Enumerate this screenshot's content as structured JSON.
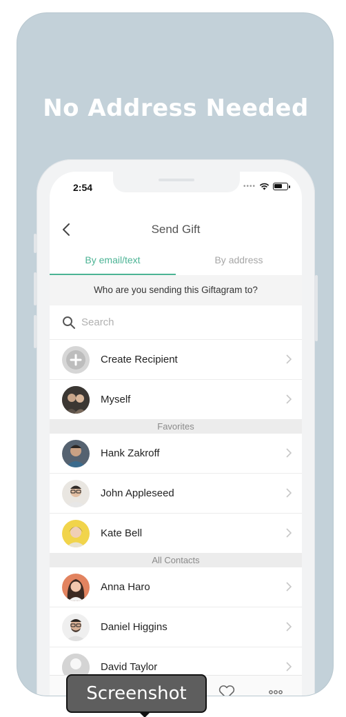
{
  "headline": "No Address Needed",
  "status": {
    "time": "2:54"
  },
  "nav": {
    "title": "Send Gift"
  },
  "tabs": [
    {
      "label": "By email/text",
      "active": true
    },
    {
      "label": "By address",
      "active": false
    }
  ],
  "prompt": "Who are you sending this Giftagram to?",
  "search": {
    "placeholder": "Search"
  },
  "actions": [
    {
      "label": "Create Recipient",
      "icon": "plus-icon"
    },
    {
      "label": "Myself",
      "icon": "avatar"
    }
  ],
  "sections": {
    "favorites": {
      "title": "Favorites",
      "items": [
        "Hank Zakroff",
        "John Appleseed",
        "Kate Bell"
      ]
    },
    "all_contacts": {
      "title": "All Contacts",
      "items": [
        "Anna Haro",
        "Daniel Higgins",
        "David Taylor"
      ]
    }
  },
  "tabbar": {
    "icons": [
      "home-icon",
      "calendar-icon",
      "search-icon",
      "heart-icon",
      "more-icon"
    ]
  },
  "tooltip": "Screenshot",
  "colors": {
    "accent": "#4bb394",
    "background": "#c3d1d9"
  }
}
